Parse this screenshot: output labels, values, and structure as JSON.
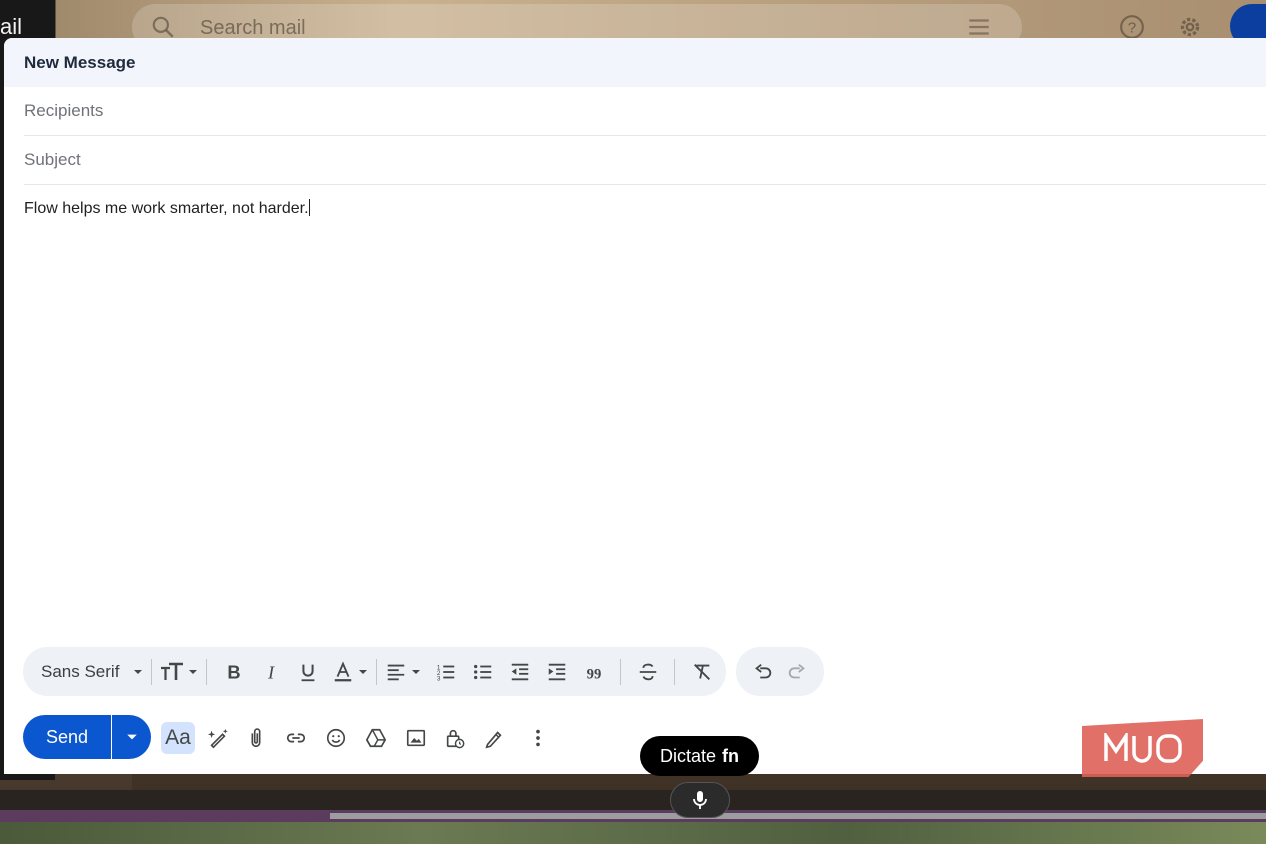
{
  "background": {
    "app_letters": "ail",
    "search_placeholder": "Search mail"
  },
  "compose": {
    "title": "New Message",
    "recipients_placeholder": "Recipients",
    "subject_placeholder": "Subject",
    "body_text": "Flow helps me work smarter, not harder."
  },
  "formatting": {
    "font_family": "Sans Serif",
    "icons": [
      "text-size-icon",
      "bold-icon",
      "italic-icon",
      "underline-icon",
      "text-color-icon",
      "align-icon",
      "numbered-list-icon",
      "bulleted-list-icon",
      "indent-less-icon",
      "indent-more-icon",
      "quote-icon",
      "strikethrough-icon",
      "remove-formatting-icon",
      "undo-icon",
      "redo-icon"
    ]
  },
  "actions": {
    "send_label": "Send",
    "format_toggle_label": "Aa",
    "icons": [
      "help-me-write-icon",
      "attach-icon",
      "link-icon",
      "emoji-icon",
      "drive-icon",
      "photo-icon",
      "confidential-icon",
      "signature-icon",
      "more-options-icon"
    ]
  },
  "dictation": {
    "label": "Dictate",
    "shortcut": "fn"
  },
  "colors": {
    "send_blue": "#0b57d0",
    "header_bg": "#f2f6fc",
    "toolbar_bg": "#eef1f6",
    "watermark": "#de6058"
  }
}
